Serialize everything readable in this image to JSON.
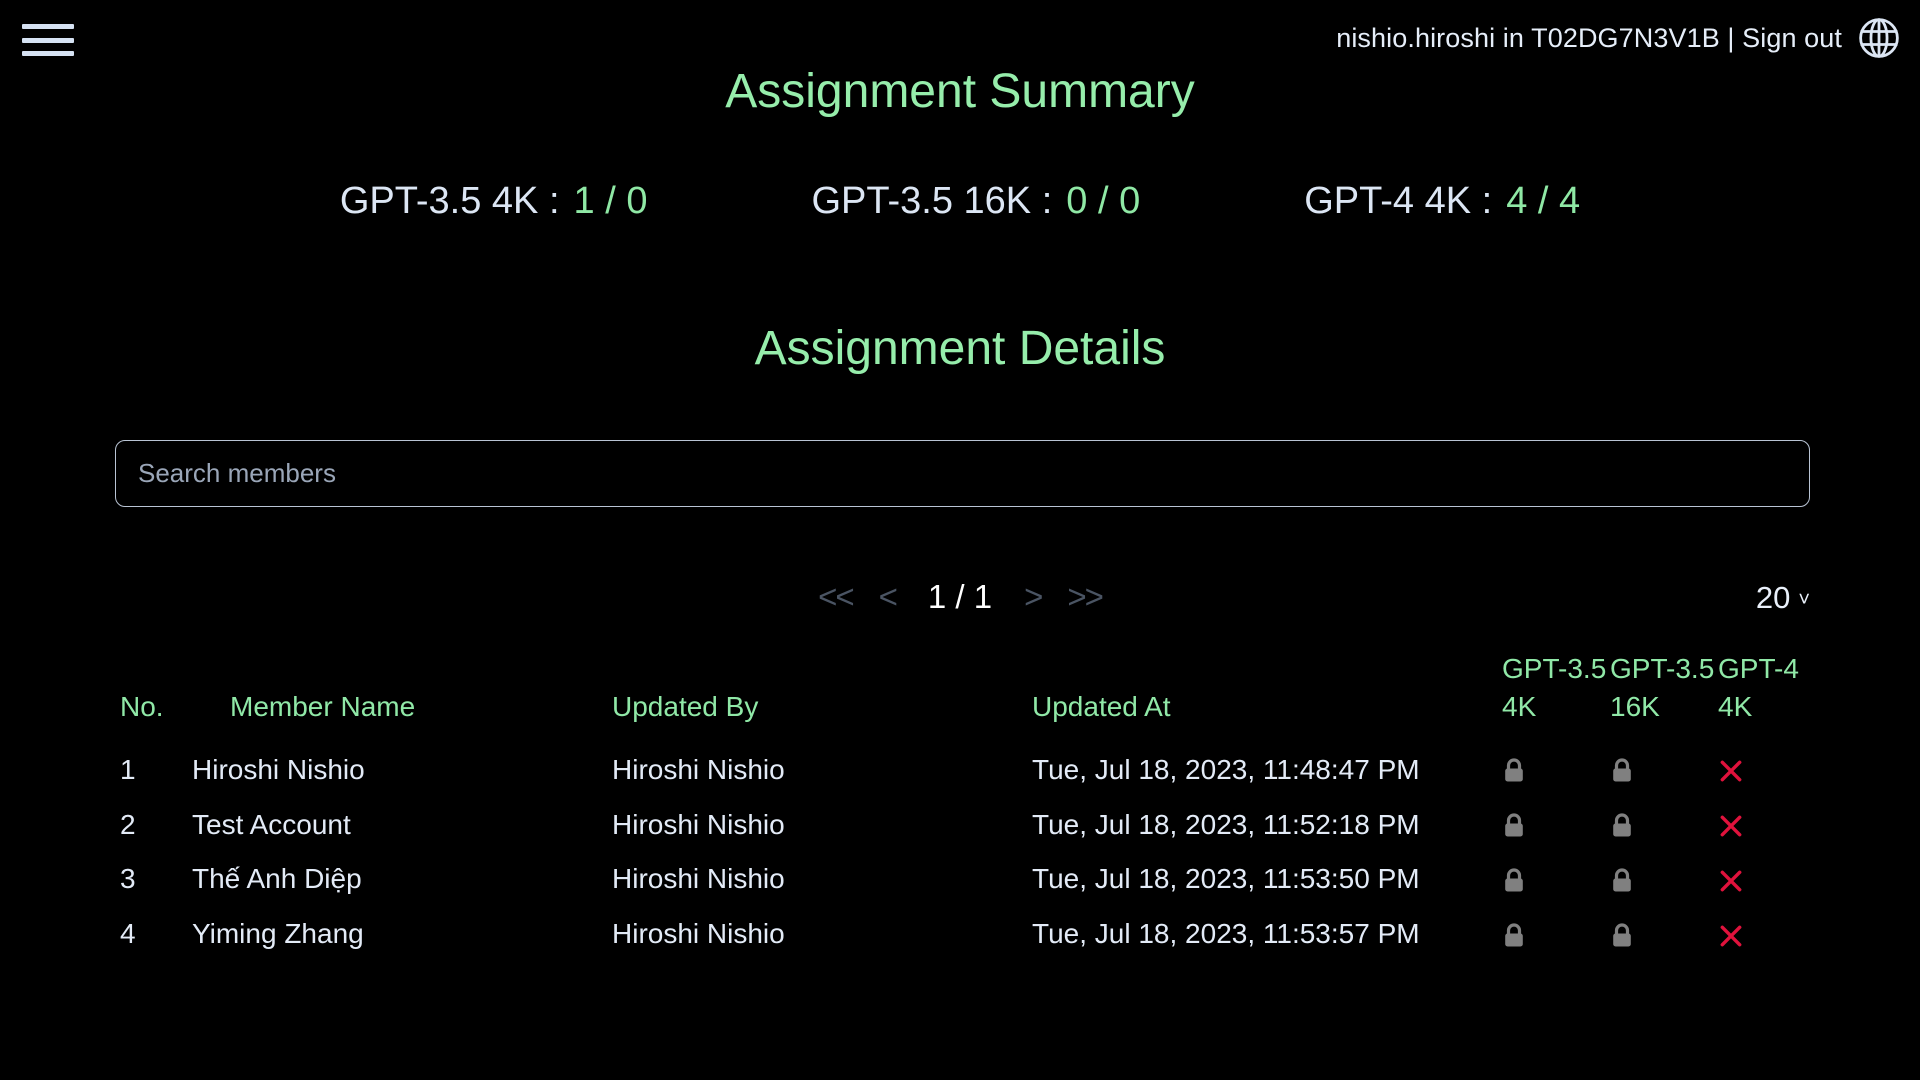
{
  "topbar": {
    "menu_icon": "hamburger-icon",
    "account_text": "nishio.hiroshi in T02DG7N3V1B | Sign out",
    "globe_icon": "globe-icon"
  },
  "headings": {
    "summary": "Assignment Summary",
    "details": "Assignment Details"
  },
  "summary_stats": [
    {
      "label": "GPT-3.5 4K :",
      "value": "1 / 0"
    },
    {
      "label": "GPT-3.5 16K :",
      "value": "0 / 0"
    },
    {
      "label": "GPT-4 4K :",
      "value": "4 / 4"
    }
  ],
  "search": {
    "placeholder": "Search members",
    "value": ""
  },
  "pagination": {
    "first_label": "<<",
    "prev_label": "<",
    "page_indicator": "1 / 1",
    "next_label": ">",
    "last_label": ">>",
    "page_size": "20",
    "chevron": "˅"
  },
  "table": {
    "headers": {
      "no": "No.",
      "member_name": "Member Name",
      "updated_by": "Updated By",
      "updated_at": "Updated At",
      "gpt35_4k": "GPT-3.5 4K",
      "gpt35_16k": "GPT-3.5 16K",
      "gpt4_4k": "GPT-4 4K"
    },
    "rows": [
      {
        "no": "1",
        "member_name": "Hiroshi Nishio",
        "updated_by": "Hiroshi Nishio",
        "updated_at": "Tue, Jul 18, 2023, 11:48:47 PM",
        "gpt35_4k": "lock-icon",
        "gpt35_16k": "lock-icon",
        "gpt4_4k": "x-icon"
      },
      {
        "no": "2",
        "member_name": "Test Account",
        "updated_by": "Hiroshi Nishio",
        "updated_at": "Tue, Jul 18, 2023, 11:52:18 PM",
        "gpt35_4k": "lock-icon",
        "gpt35_16k": "lock-icon",
        "gpt4_4k": "x-icon"
      },
      {
        "no": "3",
        "member_name": "Thế Anh Diệp",
        "updated_by": "Hiroshi Nishio",
        "updated_at": "Tue, Jul 18, 2023, 11:53:50 PM",
        "gpt35_4k": "lock-icon",
        "gpt35_16k": "lock-icon",
        "gpt4_4k": "x-icon"
      },
      {
        "no": "4",
        "member_name": "Yiming Zhang",
        "updated_by": "Hiroshi Nishio",
        "updated_at": "Tue, Jul 18, 2023, 11:53:57 PM",
        "gpt35_4k": "lock-icon",
        "gpt35_16k": "lock-icon",
        "gpt4_4k": "x-icon"
      }
    ]
  },
  "colors": {
    "background": "#000000",
    "accent_green": "#90e8a7",
    "text_primary": "#e3ebf7",
    "muted_arrow": "#4a5463",
    "lock_gray": "#808080",
    "x_red": "#e0123c"
  }
}
